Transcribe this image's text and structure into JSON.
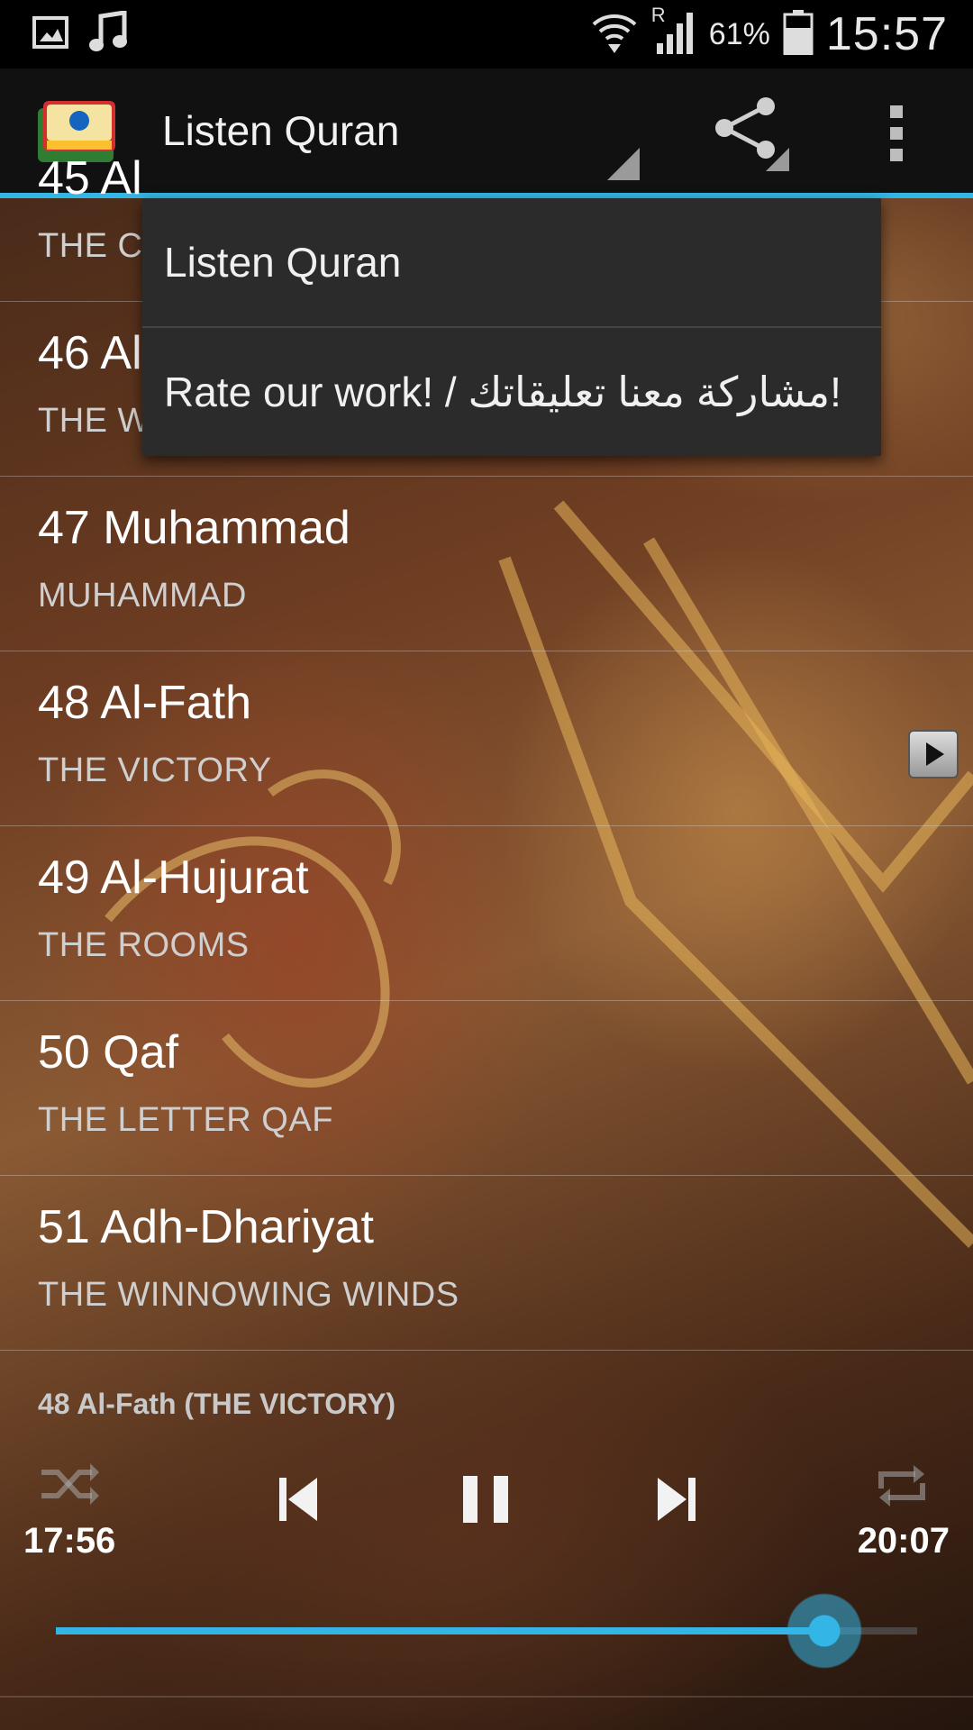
{
  "status_bar": {
    "time": "15:57",
    "battery_percent": "61%",
    "network_roaming": "R",
    "icons": [
      "image-icon",
      "music-note-icon",
      "wifi-icon",
      "signal-icon",
      "battery-icon"
    ]
  },
  "action_bar": {
    "title": "Listen Quran",
    "app_icon": "quran-app-icon",
    "share_icon": "share-icon",
    "overflow_icon": "overflow-menu-icon"
  },
  "dropdown": {
    "items": [
      "Listen Quran",
      "Rate our work! / مشاركة معنا تعليقاتك!"
    ]
  },
  "surah_list": [
    {
      "title": "45 Al",
      "subtitle": "THE C"
    },
    {
      "title": "46 Al",
      "subtitle": "THE W"
    },
    {
      "title": "47 Muhammad",
      "subtitle": "MUHAMMAD"
    },
    {
      "title": "48 Al-Fath",
      "subtitle": "THE VICTORY"
    },
    {
      "title": "49 Al-Hujurat",
      "subtitle": "THE ROOMS"
    },
    {
      "title": "50 Qaf",
      "subtitle": "THE LETTER QAF"
    },
    {
      "title": "51 Adh-Dhariyat",
      "subtitle": "THE WINNOWING WINDS"
    }
  ],
  "player": {
    "now_playing": "48 Al-Fath (THE VICTORY)",
    "elapsed": "17:56",
    "duration": "20:07",
    "progress": 0.892,
    "state": "playing",
    "controls": [
      "shuffle-icon",
      "previous-icon",
      "pause-icon",
      "next-icon",
      "repeat-icon"
    ]
  },
  "colors": {
    "accent": "#33b5e5",
    "action_bar": "#111111",
    "dropdown": "#2b2b2b"
  }
}
